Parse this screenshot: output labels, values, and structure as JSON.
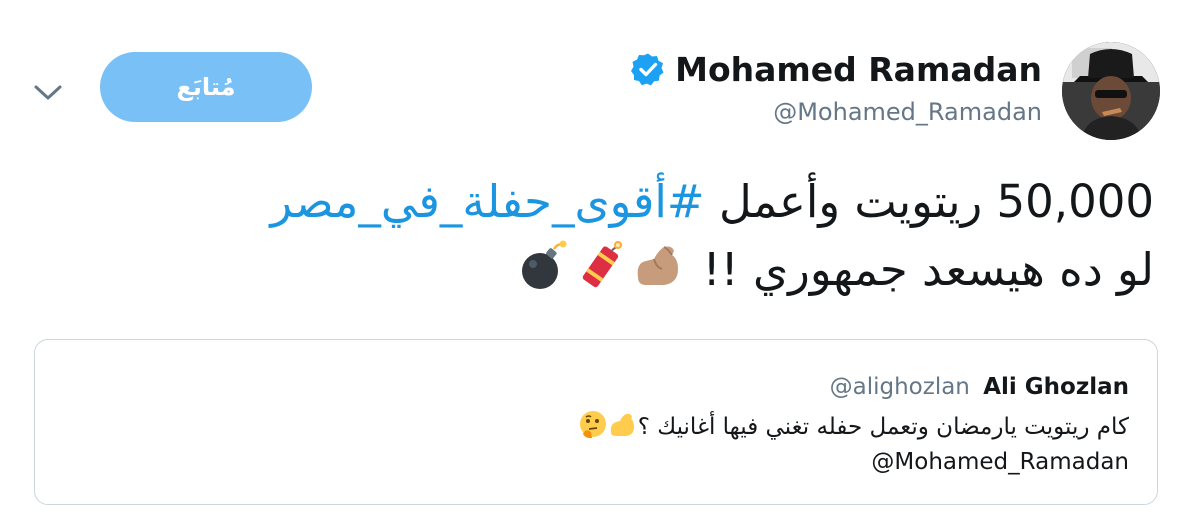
{
  "header": {
    "follow_label": "مُتابَع",
    "display_name": "Mohamed Ramadan",
    "handle": "@Mohamed_Ramadan",
    "verified_icon": "verified-badge-icon",
    "menu_icon": "chevron-down-icon"
  },
  "tweet": {
    "line1_number": "50,000",
    "line1_text": " ريتويت وأعمل ",
    "hashtag": "#أقوى_حفلة_في_مصر",
    "line2_text": "لو ده هيسعد جمهوري !! ",
    "emojis": [
      "flexed-biceps-icon",
      "firecracker-icon",
      "bomb-icon"
    ]
  },
  "quote": {
    "name": "Ali Ghozlan",
    "handle": "@alighozlan",
    "text": "كام ريتويت يارمضان وتعمل حفله تغني فيها أغانيك ؟",
    "emojis": [
      "flexed-biceps-icon",
      "thinking-face-icon"
    ],
    "mention": "@Mohamed_Ramadan"
  },
  "colors": {
    "follow_button": "#79c0f6",
    "hashtag": "#1b95e0",
    "secondary_text": "#657786",
    "border": "#ccd6dd",
    "verified": "#1da1f2"
  }
}
